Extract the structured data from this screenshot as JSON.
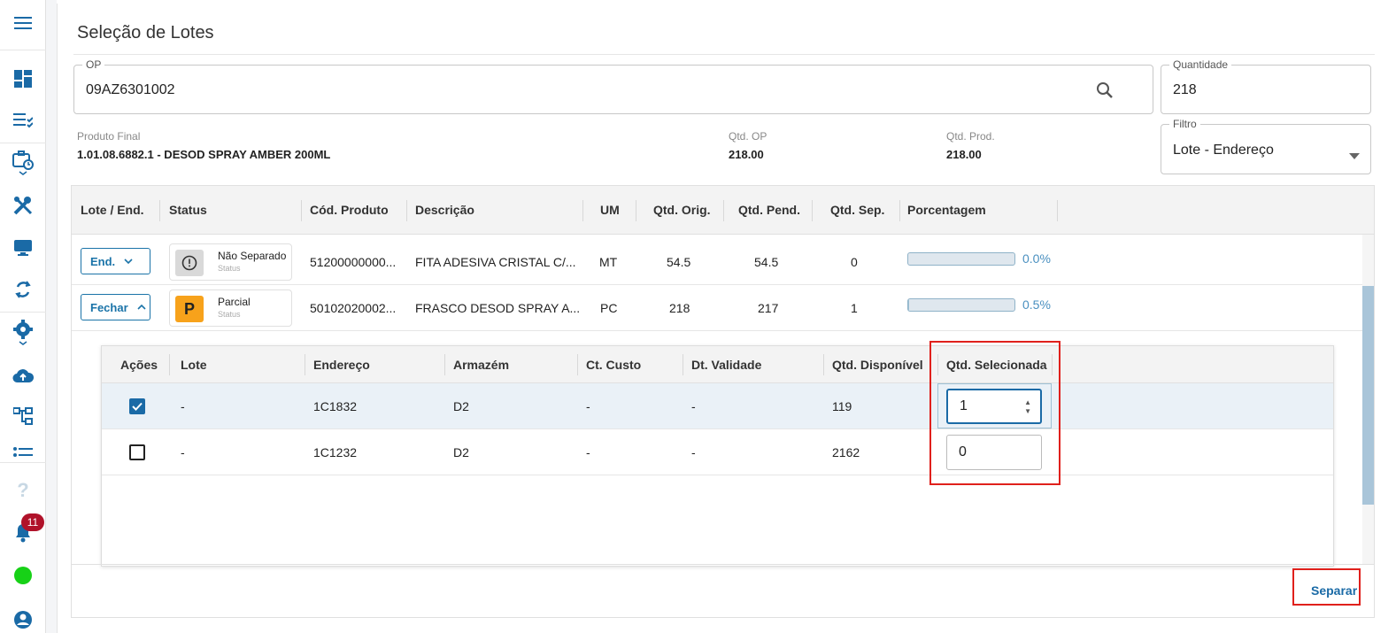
{
  "page": {
    "title": "Seleção de Lotes"
  },
  "form": {
    "op_label": "OP",
    "op_value": "09AZ6301002",
    "quantidade_label": "Quantidade",
    "quantidade_value": "218",
    "filtro_label": "Filtro",
    "filtro_value": "Lote - Endereço"
  },
  "info": {
    "produto_label": "Produto Final",
    "produto_value": "1.01.08.6882.1 - DESOD SPRAY AMBER 200ML",
    "qtd_op_label": "Qtd. OP",
    "qtd_op_value": "218.00",
    "qtd_prod_label": "Qtd. Prod.",
    "qtd_prod_value": "218.00"
  },
  "grid": {
    "columns": [
      "Lote / End.",
      "Status",
      "Cód. Produto",
      "Descrição",
      "UM",
      "Qtd. Orig.",
      "Qtd. Pend.",
      "Qtd. Sep.",
      "Porcentagem"
    ],
    "rows": [
      {
        "action": "End.",
        "status_title": "Não Separado",
        "status_sub": "Status",
        "status_glyph": "!",
        "status_color": "#d9d9d9",
        "codigo": "51200000000...",
        "descricao": "FITA ADESIVA CRISTAL C/...",
        "um": "MT",
        "qtd_orig": "54.5",
        "qtd_pend": "54.5",
        "qtd_sep": "0",
        "pct_label": "0.0%",
        "pct_value": 0.0
      },
      {
        "action": "Fechar",
        "status_title": "Parcial",
        "status_sub": "Status",
        "status_glyph": "P",
        "status_color": "#f7a21b",
        "codigo": "50102020002...",
        "descricao": "FRASCO DESOD SPRAY A...",
        "um": "PC",
        "qtd_orig": "218",
        "qtd_pend": "217",
        "qtd_sep": "1",
        "pct_label": "0.5%",
        "pct_value": 0.5
      }
    ]
  },
  "subgrid": {
    "columns": [
      "Ações",
      "Lote",
      "Endereço",
      "Armazém",
      "Ct. Custo",
      "Dt. Validade",
      "Qtd. Disponível",
      "Qtd. Selecionada"
    ],
    "rows": [
      {
        "checked": true,
        "lote": "-",
        "endereco": "1C1832",
        "armazem": "D2",
        "ct_custo": "-",
        "dt_validade": "-",
        "qtd_disponivel": "119",
        "qtd_selecionada": "1"
      },
      {
        "checked": false,
        "lote": "-",
        "endereco": "1C1232",
        "armazem": "D2",
        "ct_custo": "-",
        "dt_validade": "-",
        "qtd_disponivel": "2162",
        "qtd_selecionada": "0"
      }
    ]
  },
  "footer": {
    "separar_label": "Separar"
  },
  "sidebar": {
    "notification_count": "11"
  },
  "colors": {
    "accent": "#1a6aa6",
    "highlight": "#e0201c",
    "online": "#17d117",
    "badge": "#b0122a"
  }
}
